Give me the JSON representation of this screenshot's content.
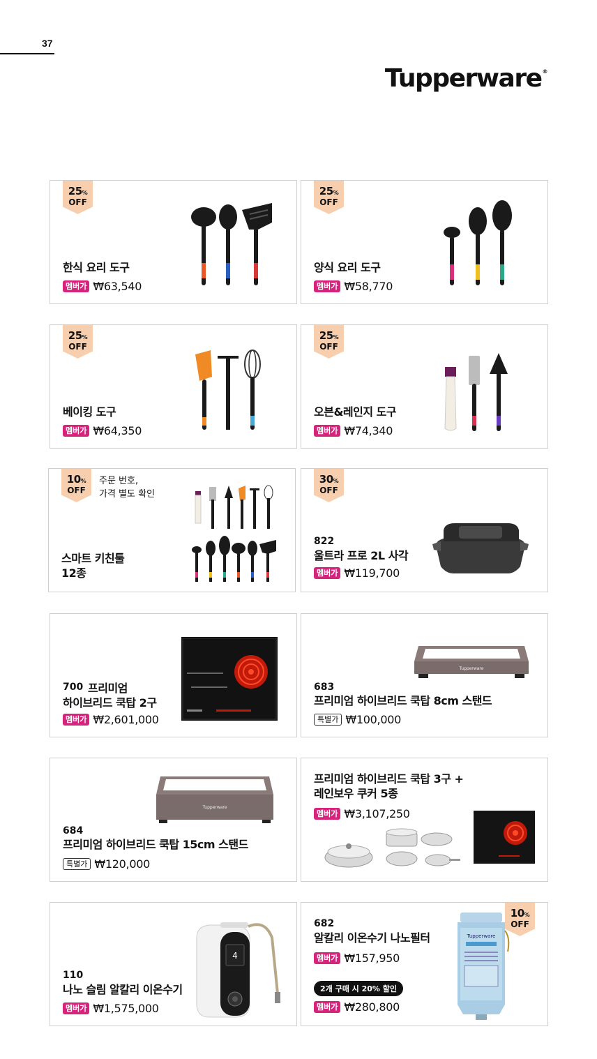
{
  "page": {
    "number": "37",
    "brand": "Tupperware",
    "brand_mark": "®"
  },
  "colors": {
    "member_tag": "#d6247d",
    "badge": "#f7cfae",
    "border": "#cfcfcf"
  },
  "products": [
    {
      "discount": "25",
      "unit": "%",
      "off": "OFF",
      "name": "한식 요리 도구",
      "tag": "멤버가",
      "price": "₩63,540"
    },
    {
      "discount": "25",
      "unit": "%",
      "off": "OFF",
      "name": "양식 요리 도구",
      "tag": "멤버가",
      "price": "₩58,770"
    },
    {
      "discount": "25",
      "unit": "%",
      "off": "OFF",
      "name": "베이킹 도구",
      "tag": "멤버가",
      "price": "₩64,350"
    },
    {
      "discount": "25",
      "unit": "%",
      "off": "OFF",
      "name": "오븐&레인지 도구",
      "tag": "멤버가",
      "price": "₩74,340"
    },
    {
      "discount": "10",
      "unit": "%",
      "off": "OFF",
      "note_line1": "주문 번호,",
      "note_line2": "가격 별도 확인",
      "name_line1": "스마트 키친툴",
      "name_line2": "12종"
    },
    {
      "discount": "30",
      "unit": "%",
      "off": "OFF",
      "number": "822",
      "name": "울트라 프로 2L 사각",
      "tag": "멤버가",
      "price": "₩119,700"
    },
    {
      "number": "700",
      "name_line1": "프리미엄",
      "name_line2": "하이브리드 쿡탑 2구",
      "tag": "멤버가",
      "price": "₩2,601,000"
    },
    {
      "number": "683",
      "name": "프리미엄 하이브리드 쿡탑 8cm 스탠드",
      "tag": "특별가",
      "price": "₩100,000",
      "product_label": "Tupperware"
    },
    {
      "number": "684",
      "name": "프리미엄 하이브리드 쿡탑 15cm 스탠드",
      "tag": "특별가",
      "price": "₩120,000",
      "product_label": "Tupperware"
    },
    {
      "name_line1": "프리미엄 하이브리드 쿡탑 3구 +",
      "name_line2": "레인보우 쿠커 5종",
      "tag": "멤버가",
      "price": "₩3,107,250"
    },
    {
      "number": "110",
      "name": "나노 슬림 알칼리 이온수기",
      "tag": "멤버가",
      "price": "₩1,575,000"
    },
    {
      "discount": "10",
      "unit": "%",
      "off": "OFF",
      "number": "682",
      "name": "알칼리 이온수기 나노필터",
      "tag": "멤버가",
      "price": "₩157,950",
      "promo": "2개 구매 시 20% 할인",
      "tag2": "멤버가",
      "price2": "₩280,800",
      "product_label": "Tupperware"
    }
  ]
}
